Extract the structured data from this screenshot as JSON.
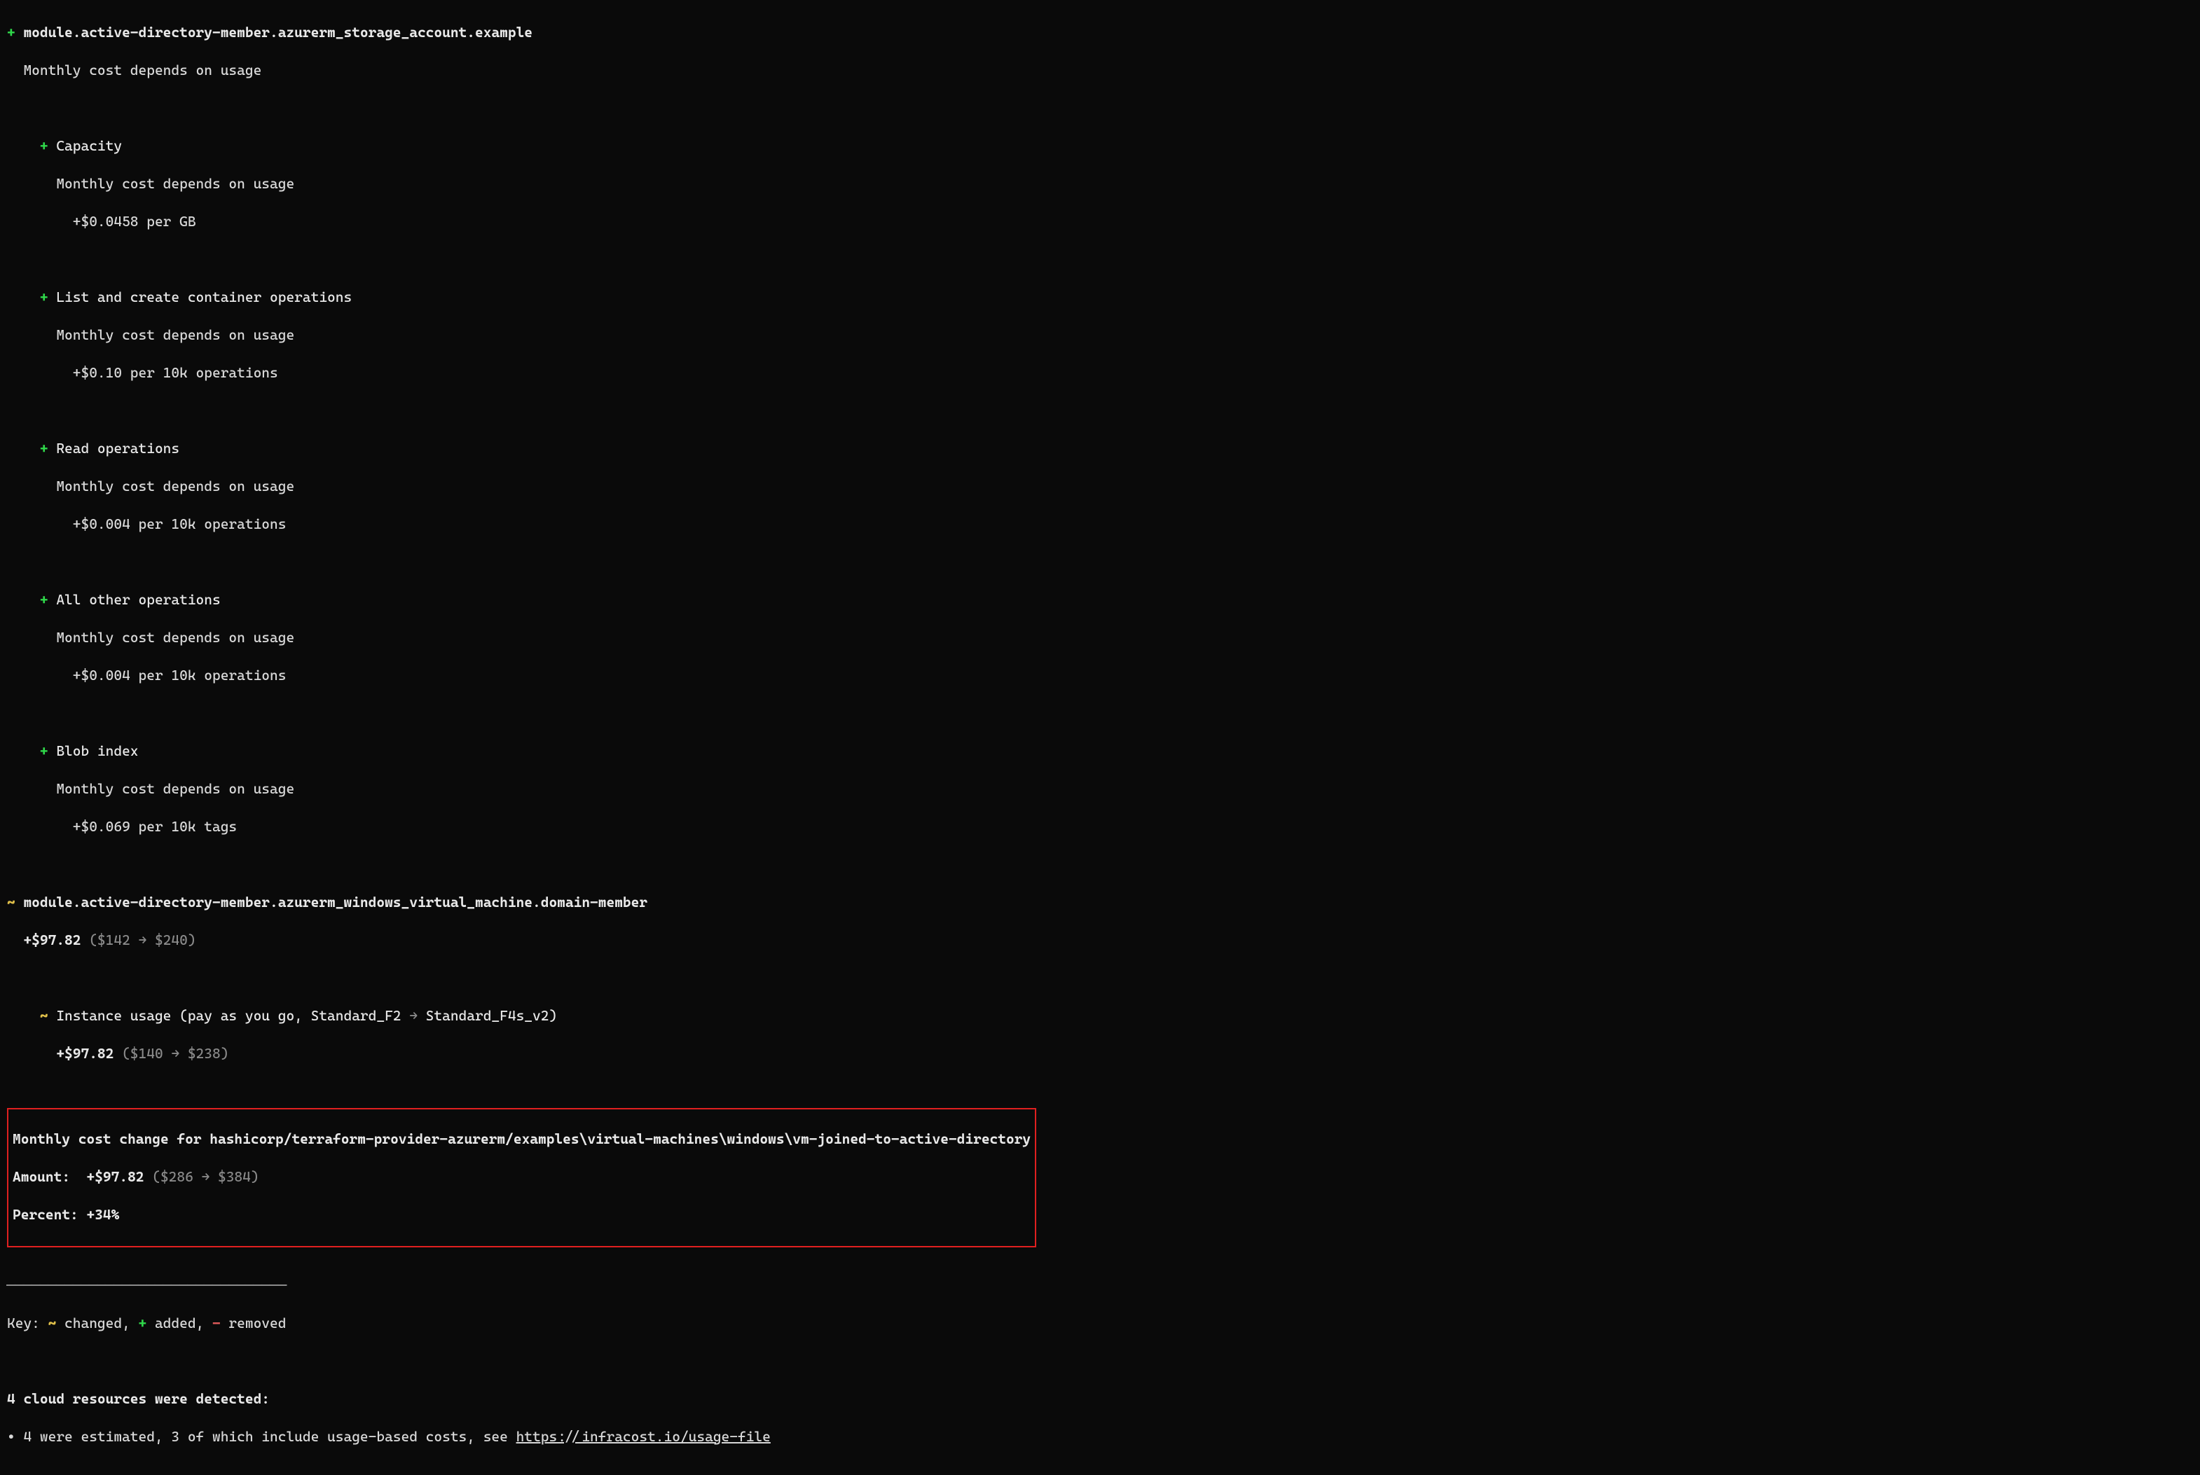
{
  "symbols": {
    "plus": "+",
    "tilde": "~",
    "minus": "-",
    "arrow": "→",
    "bullet": "•"
  },
  "resource1": {
    "title": "module.active-directory-member.azurerm_storage_account.example",
    "summary": "Monthly cost depends on usage",
    "items": [
      {
        "name": "Capacity",
        "depends": "Monthly cost depends on usage",
        "price": "+$0.0458 per GB"
      },
      {
        "name": "List and create container operations",
        "depends": "Monthly cost depends on usage",
        "price": "+$0.10 per 10k operations"
      },
      {
        "name": "Read operations",
        "depends": "Monthly cost depends on usage",
        "price": "+$0.004 per 10k operations"
      },
      {
        "name": "All other operations",
        "depends": "Monthly cost depends on usage",
        "price": "+$0.004 per 10k operations"
      },
      {
        "name": "Blob index",
        "depends": "Monthly cost depends on usage",
        "price": "+$0.069 per 10k tags"
      }
    ]
  },
  "resource2": {
    "title": "module.active-directory-member.azurerm_windows_virtual_machine.domain-member",
    "delta": "+$97.82",
    "from": "$142",
    "to": "$240",
    "sub": {
      "prefix": "Instance usage (pay as you go, Standard_F2",
      "new_type": "Standard_F4s_v2)",
      "delta": "+$97.82",
      "from": "$140",
      "to": "$238"
    }
  },
  "summary": {
    "title": "Monthly cost change for hashicorp/terraform-provider-azurerm/examples\\virtual-machines\\windows\\vm-joined-to-active-directory",
    "amount_label": "Amount:",
    "amount_delta": "+$97.82",
    "amount_from": "$286",
    "amount_to": "$384",
    "percent_label": "Percent:",
    "percent_value": "+34%"
  },
  "hr": "──────────────────────────────────",
  "key": {
    "prefix": "Key:",
    "changed": "changed,",
    "added": "added,",
    "removed": "removed"
  },
  "footer": {
    "detected": "4 cloud resources were detected:",
    "estimated_prefix": "4 were estimated, 3 of which include usage-based costs, see ",
    "link_text": "https://infracost.io/usage-file"
  }
}
